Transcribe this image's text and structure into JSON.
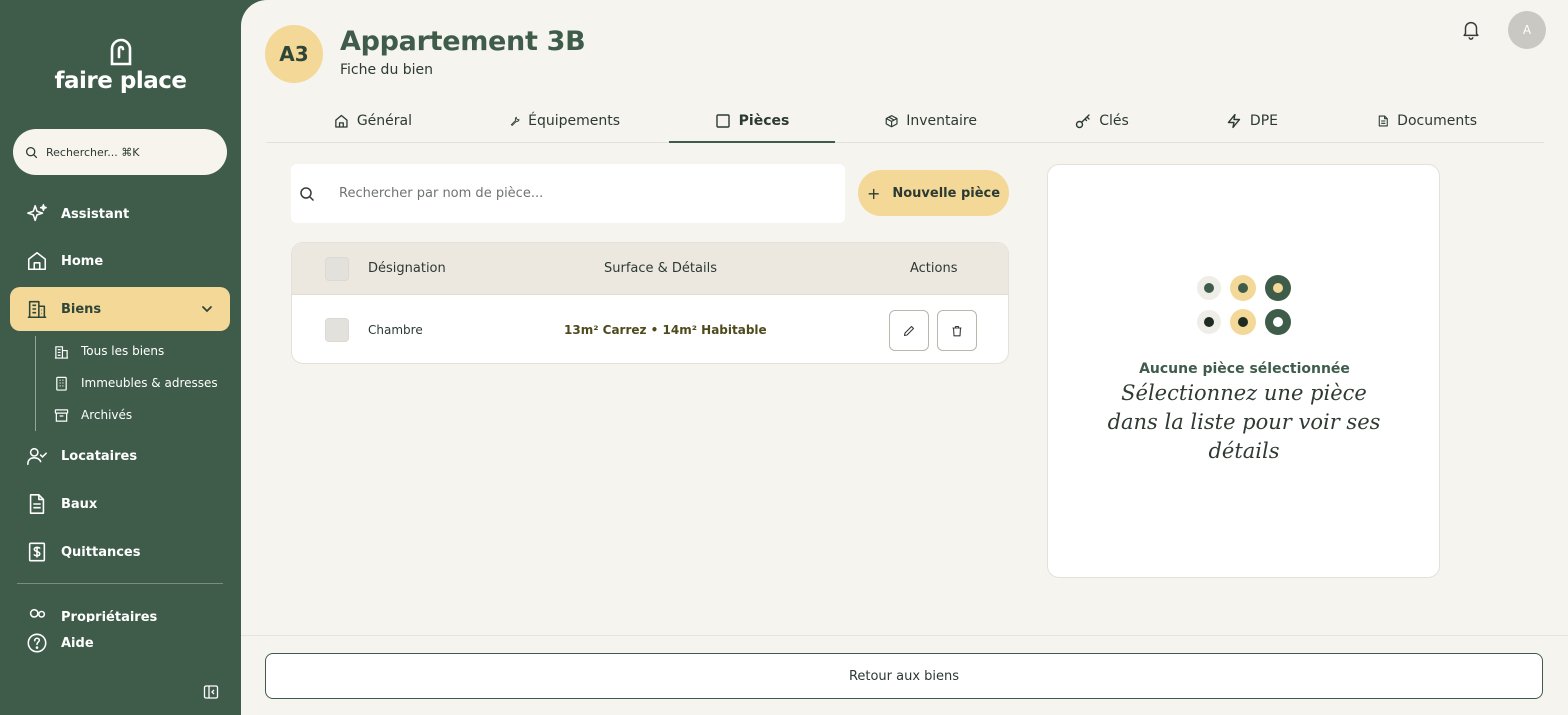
{
  "sidebar": {
    "logo": "faire place",
    "search_placeholder": "Rechercher... ⌘K",
    "items": [
      {
        "label": "Assistant",
        "icon": "sparkles-icon"
      },
      {
        "label": "Home",
        "icon": "home-icon"
      },
      {
        "label": "Biens",
        "icon": "building-icon",
        "active": true
      },
      {
        "label": "Locataires",
        "icon": "user-check-icon"
      },
      {
        "label": "Baux",
        "icon": "file-text-icon"
      },
      {
        "label": "Quittances",
        "icon": "receipt-icon"
      },
      {
        "label": "Propriétaires",
        "icon": "users-icon"
      },
      {
        "label": "Aide",
        "icon": "help-circle-icon"
      }
    ],
    "sub_items": [
      {
        "label": "Tous les biens",
        "icon": "buildings-icon"
      },
      {
        "label": "Immeubles & adresses",
        "icon": "building-2-icon"
      },
      {
        "label": "Archivés",
        "icon": "archive-icon"
      }
    ]
  },
  "header": {
    "badge": "A3",
    "title": "Appartement 3B",
    "subtitle": "Fiche du bien",
    "avatar": "A"
  },
  "tabs": [
    {
      "label": "Général",
      "icon": "home-icon"
    },
    {
      "label": "Équipements",
      "icon": "wrench-icon"
    },
    {
      "label": "Pièces",
      "icon": "square-icon",
      "active": true
    },
    {
      "label": "Inventaire",
      "icon": "package-icon"
    },
    {
      "label": "Clés",
      "icon": "key-icon"
    },
    {
      "label": "DPE",
      "icon": "zap-icon"
    },
    {
      "label": "Documents",
      "icon": "document-icon"
    }
  ],
  "rooms": {
    "search_placeholder": "Rechercher par nom de pièce...",
    "new_button": "Nouvelle pièce",
    "columns": [
      "Désignation",
      "Surface & Détails",
      "Actions"
    ],
    "rows": [
      {
        "name": "Chambre",
        "surface": "13m² Carrez • 14m² Habitable"
      }
    ]
  },
  "detail": {
    "empty_title": "Aucune pièce sélectionnée",
    "empty_text": "Sélectionnez une pièce dans la liste pour voir ses détails"
  },
  "footer": {
    "back_button": "Retour aux biens"
  },
  "colors": {
    "primary": "#3f5c4b",
    "accent": "#f3d898",
    "background": "#f5f4ef"
  }
}
